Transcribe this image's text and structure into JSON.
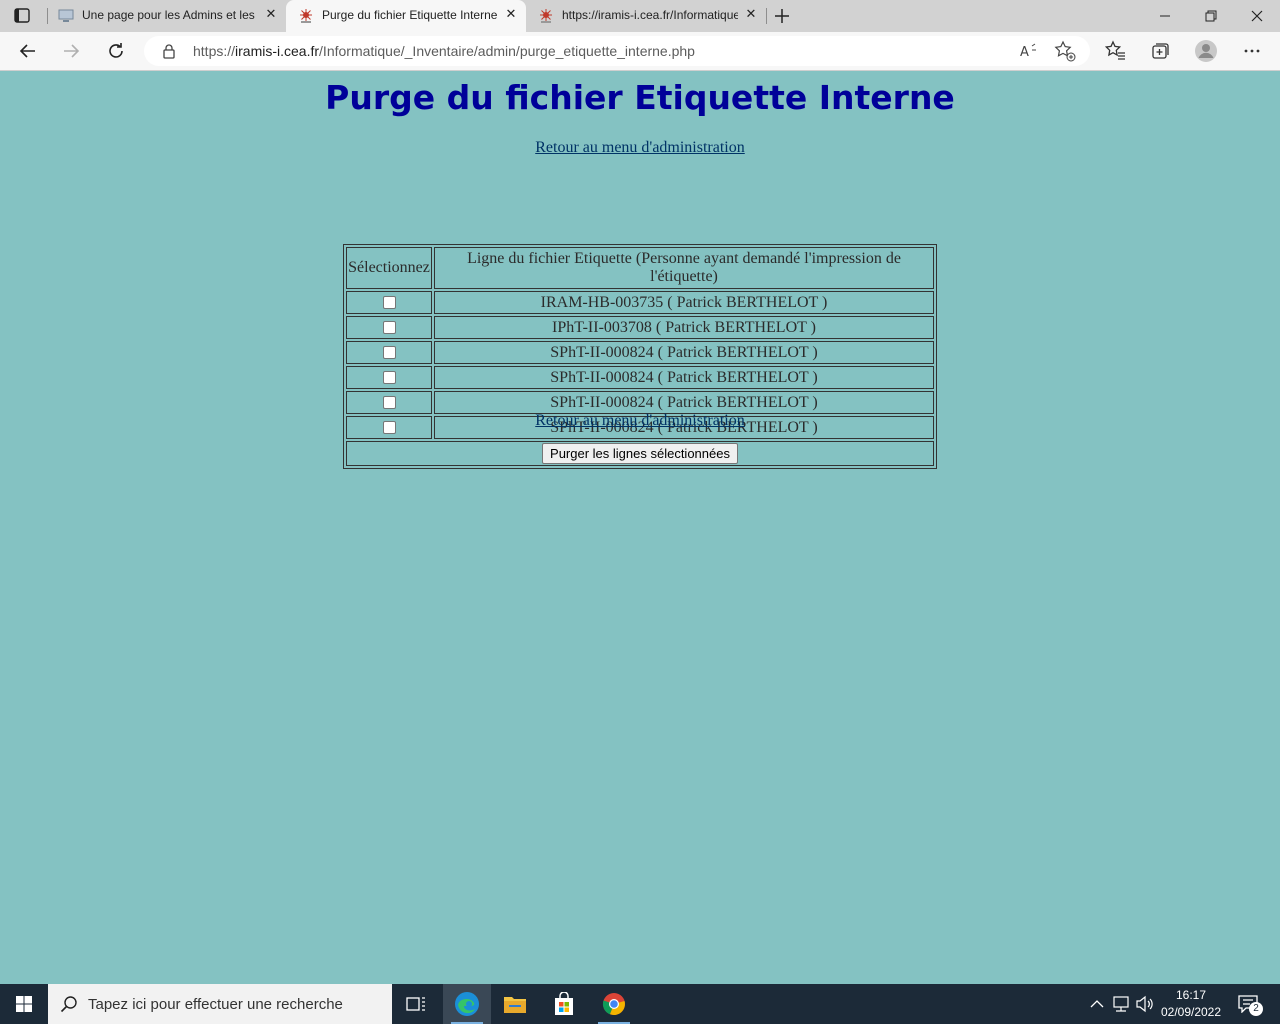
{
  "browser": {
    "tabs": [
      {
        "title": "Une page pour les Admins et les",
        "active": false
      },
      {
        "title": "Purge du fichier Etiquette Interne",
        "active": true
      },
      {
        "title": "https://iramis-i.cea.fr/Informatique",
        "active": false
      }
    ],
    "url": {
      "scheme": "https://",
      "host": "iramis-i.cea.fr",
      "path": "/Informatique/_Inventaire/admin/purge_etiquette_interne.php"
    }
  },
  "page": {
    "title": "Purge du fichier Etiquette Interne",
    "admin_link": "Retour au menu d'administration",
    "table": {
      "header_select": "Sélectionnez",
      "header_line": "Ligne du fichier Etiquette (Personne ayant demandé l'impression de l'étiquette)",
      "rows": [
        {
          "label": "IRAM-HB-003735 ( Patrick BERTHELOT )",
          "checked": false
        },
        {
          "label": "IPhT-II-003708 ( Patrick BERTHELOT )",
          "checked": false
        },
        {
          "label": "SPhT-II-000824 ( Patrick BERTHELOT )",
          "checked": false
        },
        {
          "label": "SPhT-II-000824 ( Patrick BERTHELOT )",
          "checked": false
        },
        {
          "label": "SPhT-II-000824 ( Patrick BERTHELOT )",
          "checked": false
        },
        {
          "label": "SPhT-II-000824 ( Patrick BERTHELOT )",
          "checked": false
        }
      ],
      "purge_button": "Purger les lignes sélectionnées"
    }
  },
  "taskbar": {
    "search_placeholder": "Tapez ici pour effectuer une recherche",
    "time": "16:17",
    "date": "02/09/2022",
    "notification_count": "2"
  },
  "colors": {
    "page_background": "#84c2c2",
    "title": "#000099",
    "link": "#003366",
    "taskbar": "#1c2a38"
  },
  "icons": [
    "tab-actions-icon",
    "monitor-favicon-icon",
    "site-favicon-icon",
    "close-icon",
    "new-tab-icon",
    "minimize-icon",
    "restore-icon",
    "window-close-icon",
    "back-icon",
    "forward-icon",
    "refresh-icon",
    "lock-icon",
    "read-aloud-icon",
    "add-favorite-icon",
    "favorites-icon",
    "collections-icon",
    "profile-icon",
    "more-icon",
    "windows-start-icon",
    "search-icon",
    "task-view-icon",
    "edge-icon",
    "file-explorer-icon",
    "store-icon",
    "chrome-icon",
    "chevron-up-icon",
    "network-icon",
    "volume-icon",
    "notifications-icon"
  ]
}
